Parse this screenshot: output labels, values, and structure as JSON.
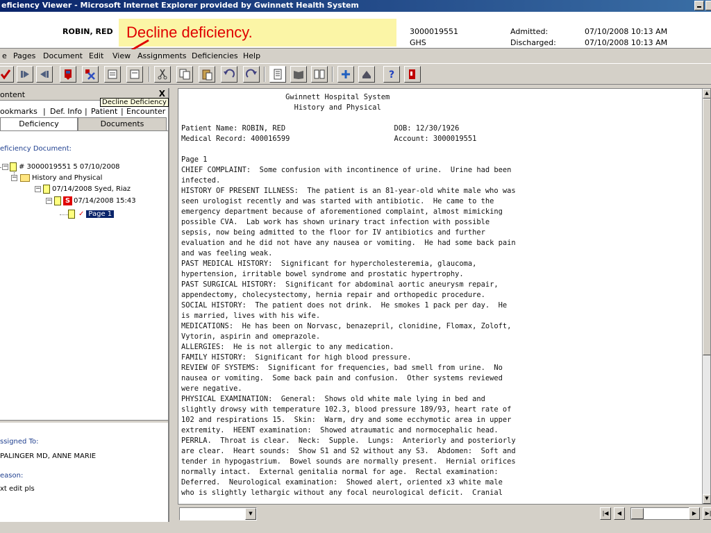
{
  "window": {
    "title": "eficiency Viewer - Microsoft Internet Explorer provided by Gwinnett Health System"
  },
  "patient": {
    "name": "ROBIN, RED",
    "account": "3000019551",
    "facility": "GHS",
    "admitted_label": "Admitted:",
    "admitted_value": "07/10/2008 10:13 AM",
    "discharged_label": "Discharged:",
    "discharged_value": "07/10/2008 10:13 AM",
    "comma": ","
  },
  "callout": {
    "text": "Decline deficiency.",
    "color": "#e00000",
    "background": "#fbf5a6"
  },
  "menu": [
    "e",
    "Pages",
    "Document",
    "Edit",
    "View",
    "Assignments",
    "Deficiencies",
    "Help"
  ],
  "toolbar": {
    "icons": [
      "check-icon",
      "forward-icon",
      "back-icon",
      "flag-icon",
      "decline-x-icon",
      "note-icon",
      "note2-icon",
      "cut-icon",
      "copy-icon",
      "paste-icon",
      "undo-icon",
      "redo-icon",
      "single-page-icon",
      "book-icon",
      "multi-page-icon",
      "add-icon",
      "stamp-icon",
      "help-icon",
      "exit-icon"
    ]
  },
  "left_panel": {
    "content_title": "ontent",
    "close_label": "X",
    "tooltip": "Decline Deficiency",
    "tabs_row1": [
      "ookmarks",
      "Def. Info",
      "Patient",
      "Encounter"
    ],
    "tab_separator": "|",
    "tabs_row2": [
      "Deficiency",
      "Documents"
    ],
    "def_doc_label": "eficiency Document:",
    "tree": {
      "root": "# 3000019551  5  07/10/2008",
      "folder": "History and Physical",
      "doc": "07/14/2008 Syed, Riaz",
      "sig": "07/14/2008 15:43",
      "s_label": "S",
      "check": "✓",
      "page": "Page 1"
    },
    "assigned_label": "ssigned To:",
    "assigned_value": "PALINGER MD, ANNE MARIE",
    "reason_label": "eason:",
    "reason_value": "xt edit pls"
  },
  "document": {
    "lines": [
      "                        Gwinnett Hospital System",
      "                          History and Physical",
      "",
      "Patient Name: ROBIN, RED                         DOB: 12/30/1926",
      "Medical Record: 400016599                        Account: 3000019551",
      "",
      "Page 1",
      "CHIEF COMPLAINT:  Some confusion with incontinence of urine.  Urine had been",
      "infected.",
      "HISTORY OF PRESENT ILLNESS:  The patient is an 81-year-old white male who was",
      "seen urologist recently and was started with antibiotic.  He came to the",
      "emergency department because of aforementioned complaint, almost mimicking",
      "possible CVA.  Lab work has shown urinary tract infection with possible",
      "sepsis, now being admitted to the floor for IV antibiotics and further",
      "evaluation and he did not have any nausea or vomiting.  He had some back pain",
      "and was feeling weak.",
      "PAST MEDICAL HISTORY:  Significant for hypercholesteremia, glaucoma,",
      "hypertension, irritable bowel syndrome and prostatic hypertrophy.",
      "PAST SURGICAL HISTORY:  Significant for abdominal aortic aneurysm repair,",
      "appendectomy, cholecystectomy, hernia repair and orthopedic procedure.",
      "SOCIAL HISTORY:  The patient does not drink.  He smokes 1 pack per day.  He",
      "is married, lives with his wife.",
      "MEDICATIONS:  He has been on Norvasc, benazepril, clonidine, Flomax, Zoloft,",
      "Vytorin, aspirin and omeprazole.",
      "ALLERGIES:  He is not allergic to any medication.",
      "FAMILY HISTORY:  Significant for high blood pressure.",
      "REVIEW OF SYSTEMS:  Significant for frequencies, bad smell from urine.  No",
      "nausea or vomiting.  Some back pain and confusion.  Other systems reviewed",
      "were negative.",
      "PHYSICAL EXAMINATION:  General:  Shows old white male lying in bed and",
      "slightly drowsy with temperature 102.3, blood pressure 189/93, heart rate of",
      "102 and respirations 15.  Skin:  Warm, dry and some ecchymotic area in upper",
      "extremity.  HEENT examination:  Showed atraumatic and normocephalic head.",
      "PERRLA.  Throat is clear.  Neck:  Supple.  Lungs:  Anteriorly and posteriorly",
      "are clear.  Heart sounds:  Show S1 and S2 without any S3.  Abdomen:  Soft and",
      "tender in hypogastrium.  Bowel sounds are normally present.  Hernial orifices",
      "normally intact.  External genitalia normal for age.  Rectal examination:",
      "Deferred.  Neurological examination:  Showed alert, oriented x3 white male",
      "who is slightly lethargic without any focal neurological deficit.  Cranial"
    ]
  },
  "bottom_bar": {
    "first_label": "|◀",
    "prev_label": "◀",
    "next_label": "▶",
    "last_label": "▶|"
  }
}
